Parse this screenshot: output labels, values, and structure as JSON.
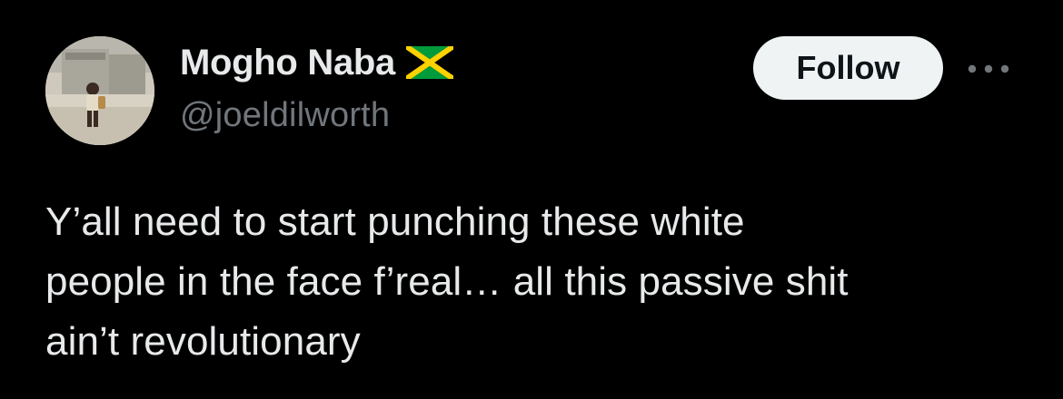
{
  "author": {
    "display_name": "Mogho Naba",
    "handle": "@joeldilworth",
    "flag_icon": "jamaica-flag-icon",
    "avatar_icon": "avatar-photo-icon"
  },
  "actions": {
    "follow_label": "Follow",
    "more_icon": "more-horizontal-icon"
  },
  "tweet": {
    "text": "Y’all need to start punching these white\npeople in the face f’real… all this passive shit\nain’t revolutionary"
  },
  "colors": {
    "background": "#000000",
    "text_primary": "#e7e9ea",
    "text_secondary": "#71767b",
    "follow_bg": "#eff3f4",
    "follow_text": "#0f1419",
    "flag_green": "#009b3a",
    "flag_gold": "#fed100",
    "flag_black": "#000000"
  }
}
